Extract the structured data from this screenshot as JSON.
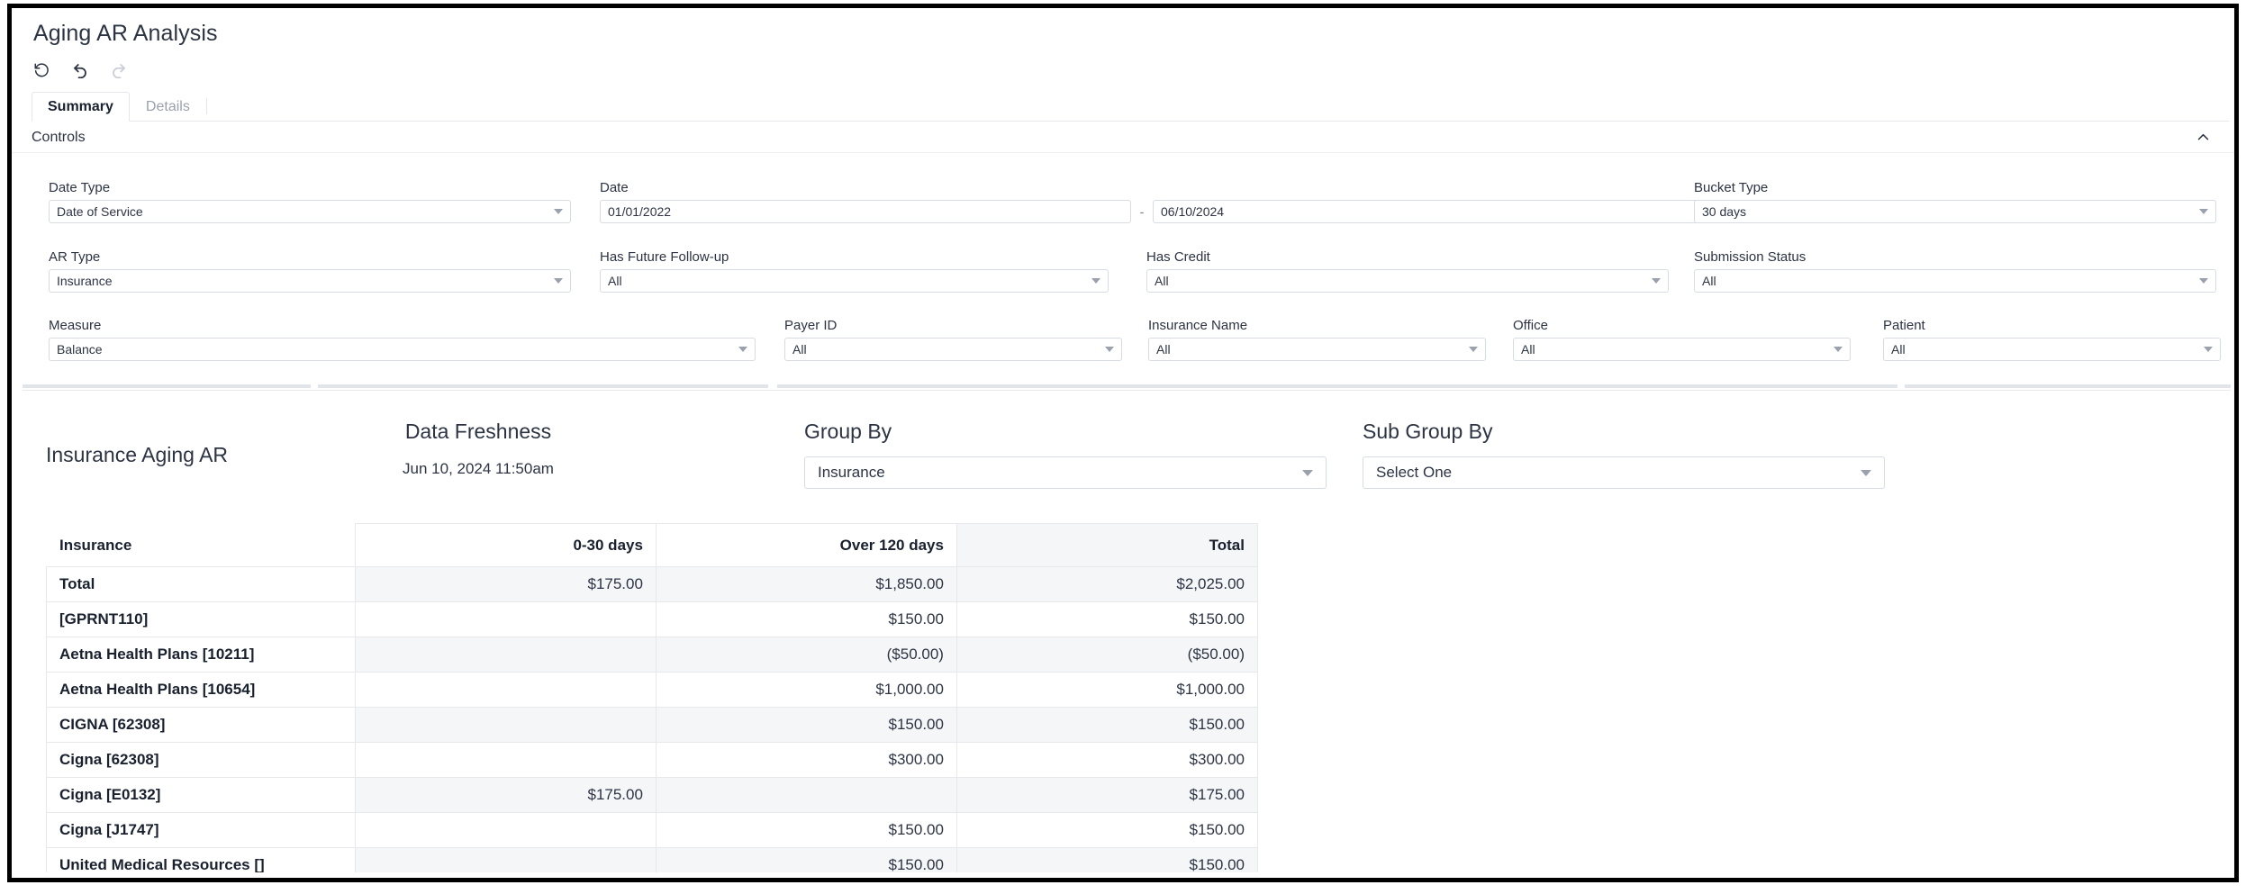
{
  "page": {
    "title": "Aging AR Analysis"
  },
  "history_toolbar": {
    "revert_label": "revert-icon",
    "undo_label": "undo-icon",
    "redo_label": "redo-icon"
  },
  "tabs": [
    {
      "label": "Summary",
      "active": true
    },
    {
      "label": "Details",
      "active": false
    }
  ],
  "controls": {
    "title": "Controls",
    "collapse_icon": "chevron-up-icon",
    "fields": {
      "date_type": {
        "label": "Date Type",
        "value": "Date of Service"
      },
      "date": {
        "label": "Date",
        "from": "01/01/2022",
        "separator": "-",
        "to": "06/10/2024"
      },
      "bucket_type": {
        "label": "Bucket Type",
        "value": "30 days"
      },
      "ar_type": {
        "label": "AR Type",
        "value": "Insurance"
      },
      "has_future_followup": {
        "label": "Has Future Follow-up",
        "value": "All"
      },
      "has_credit": {
        "label": "Has Credit",
        "value": "All"
      },
      "submission_status": {
        "label": "Submission Status",
        "value": "All"
      },
      "measure": {
        "label": "Measure",
        "value": "Balance"
      },
      "payer_id": {
        "label": "Payer ID",
        "value": "All"
      },
      "insurance_name": {
        "label": "Insurance Name",
        "value": "All"
      },
      "office": {
        "label": "Office",
        "value": "All"
      },
      "patient": {
        "label": "Patient",
        "value": "All"
      }
    }
  },
  "results": {
    "report_name": "Insurance Aging AR",
    "data_freshness": {
      "label": "Data Freshness",
      "value": "Jun 10, 2024 11:50am"
    },
    "group_by": {
      "label": "Group By",
      "value": "Insurance"
    },
    "sub_group_by": {
      "label": "Sub Group By",
      "value": "Select One"
    },
    "table": {
      "columns": [
        "Insurance",
        "0-30 days",
        "Over 120 days",
        "Total"
      ],
      "rows": [
        {
          "label": "Total",
          "cells": [
            "$175.00",
            "$1,850.00",
            "$2,025.00"
          ]
        },
        {
          "label": "[GPRNT110]",
          "cells": [
            "",
            "$150.00",
            "$150.00"
          ]
        },
        {
          "label": "Aetna Health Plans [10211]",
          "cells": [
            "",
            "($50.00)",
            "($50.00)"
          ]
        },
        {
          "label": "Aetna Health Plans [10654]",
          "cells": [
            "",
            "$1,000.00",
            "$1,000.00"
          ]
        },
        {
          "label": "CIGNA [62308]",
          "cells": [
            "",
            "$150.00",
            "$150.00"
          ]
        },
        {
          "label": "Cigna [62308]",
          "cells": [
            "",
            "$300.00",
            "$300.00"
          ]
        },
        {
          "label": "Cigna [E0132]",
          "cells": [
            "$175.00",
            "",
            "$175.00"
          ]
        },
        {
          "label": "Cigna [J1747]",
          "cells": [
            "",
            "$150.00",
            "$150.00"
          ]
        },
        {
          "label": "United Medical Resources []",
          "cells": [
            "",
            "$150.00",
            "$150.00"
          ]
        }
      ]
    }
  },
  "colors": {
    "text": "#2c3443",
    "heading": "#19212f",
    "muted": "#9aa1ad",
    "border": "#d7dce2",
    "shade": "#f5f6f8"
  }
}
